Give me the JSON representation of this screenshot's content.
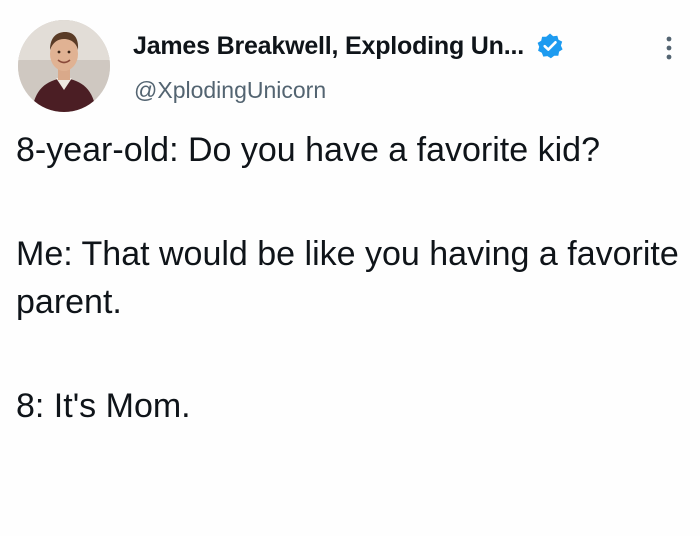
{
  "author": {
    "display_name": "James Breakwell, Exploding Un...",
    "handle": "@XplodingUnicorn",
    "verified": true
  },
  "tweet": {
    "paragraphs": [
      "8-year-old: Do you have a favorite kid?",
      "Me: That would be like you having a favorite parent.",
      "8: It's Mom."
    ]
  },
  "icons": {
    "verified": "verified-badge-icon",
    "more": "more-options-icon"
  },
  "colors": {
    "text": "#0f1419",
    "handle": "#536471",
    "verified": "#1d9bf0"
  }
}
